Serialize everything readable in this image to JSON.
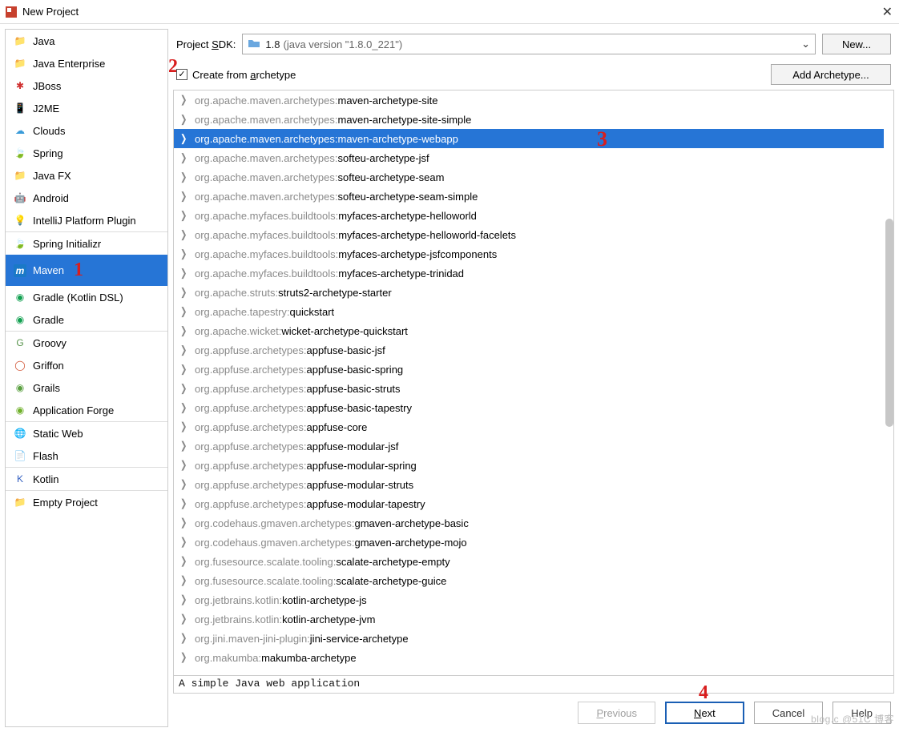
{
  "window": {
    "title": "New Project"
  },
  "sidebar": [
    {
      "label": "Java",
      "icon": "📁",
      "color": "#6aa7df",
      "sep": false
    },
    {
      "label": "Java Enterprise",
      "icon": "📁",
      "color": "#6aa7df",
      "sep": false
    },
    {
      "label": "JBoss",
      "icon": "✱",
      "color": "#d03030",
      "sep": false
    },
    {
      "label": "J2ME",
      "icon": "📱",
      "color": "#2c7bd1",
      "sep": false
    },
    {
      "label": "Clouds",
      "icon": "☁",
      "color": "#3a9bd9",
      "sep": false
    },
    {
      "label": "Spring",
      "icon": "🍃",
      "color": "#37a637",
      "sep": false
    },
    {
      "label": "Java FX",
      "icon": "📁",
      "color": "#6aa7df",
      "sep": false
    },
    {
      "label": "Android",
      "icon": "🤖",
      "color": "#76b000",
      "sep": false
    },
    {
      "label": "IntelliJ Platform Plugin",
      "icon": "💡",
      "color": "#999",
      "sep": true
    },
    {
      "label": "Spring Initializr",
      "icon": "🍃",
      "color": "#37a637",
      "sep": false
    },
    {
      "label": "Maven",
      "icon": "m",
      "color": "#fff",
      "bg": "#1a79c7",
      "selected": true,
      "annot": "1"
    },
    {
      "label": "Gradle (Kotlin DSL)",
      "icon": "◉",
      "color": "#11a050",
      "sep": false
    },
    {
      "label": "Gradle",
      "icon": "◉",
      "color": "#11a050",
      "sep": true
    },
    {
      "label": "Groovy",
      "icon": "G",
      "color": "#5b9650",
      "sep": false
    },
    {
      "label": "Griffon",
      "icon": "◯",
      "color": "#d05030",
      "sep": false
    },
    {
      "label": "Grails",
      "icon": "◉",
      "color": "#5aa040",
      "sep": false
    },
    {
      "label": "Application Forge",
      "icon": "◉",
      "color": "#6fb02a",
      "sep": true
    },
    {
      "label": "Static Web",
      "icon": "🌐",
      "color": "#2f92e0",
      "sep": false
    },
    {
      "label": "Flash",
      "icon": "📄",
      "color": "#c75d20",
      "sep": true
    },
    {
      "label": "Kotlin",
      "icon": "K",
      "color": "#335fc0",
      "sep": true
    },
    {
      "label": "Empty Project",
      "icon": "📁",
      "color": "#6aa7df",
      "sep": false
    }
  ],
  "sdk": {
    "label_pre": "Project ",
    "label_u": "S",
    "label_post": "DK:",
    "value": "1.8",
    "hint": "(java version \"1.8.0_221\")",
    "new_button": "New..."
  },
  "create_from": {
    "checked": true,
    "label_pre": "Create from ",
    "label_u": "a",
    "label_post": "rchetype",
    "add_button": "Add Archetype..."
  },
  "annotations": {
    "a1": "1",
    "a2": "2",
    "a3": "3",
    "a4": "4"
  },
  "archetypes": [
    {
      "prefix": "org.apache.maven.archetypes:",
      "name": "maven-archetype-site"
    },
    {
      "prefix": "org.apache.maven.archetypes:",
      "name": "maven-archetype-site-simple"
    },
    {
      "prefix": "org.apache.maven.archetypes:",
      "name": "maven-archetype-webapp",
      "selected": true
    },
    {
      "prefix": "org.apache.maven.archetypes:",
      "name": "softeu-archetype-jsf"
    },
    {
      "prefix": "org.apache.maven.archetypes:",
      "name": "softeu-archetype-seam"
    },
    {
      "prefix": "org.apache.maven.archetypes:",
      "name": "softeu-archetype-seam-simple"
    },
    {
      "prefix": "org.apache.myfaces.buildtools:",
      "name": "myfaces-archetype-helloworld"
    },
    {
      "prefix": "org.apache.myfaces.buildtools:",
      "name": "myfaces-archetype-helloworld-facelets"
    },
    {
      "prefix": "org.apache.myfaces.buildtools:",
      "name": "myfaces-archetype-jsfcomponents"
    },
    {
      "prefix": "org.apache.myfaces.buildtools:",
      "name": "myfaces-archetype-trinidad"
    },
    {
      "prefix": "org.apache.struts:",
      "name": "struts2-archetype-starter"
    },
    {
      "prefix": "org.apache.tapestry:",
      "name": "quickstart"
    },
    {
      "prefix": "org.apache.wicket:",
      "name": "wicket-archetype-quickstart"
    },
    {
      "prefix": "org.appfuse.archetypes:",
      "name": "appfuse-basic-jsf"
    },
    {
      "prefix": "org.appfuse.archetypes:",
      "name": "appfuse-basic-spring"
    },
    {
      "prefix": "org.appfuse.archetypes:",
      "name": "appfuse-basic-struts"
    },
    {
      "prefix": "org.appfuse.archetypes:",
      "name": "appfuse-basic-tapestry"
    },
    {
      "prefix": "org.appfuse.archetypes:",
      "name": "appfuse-core"
    },
    {
      "prefix": "org.appfuse.archetypes:",
      "name": "appfuse-modular-jsf"
    },
    {
      "prefix": "org.appfuse.archetypes:",
      "name": "appfuse-modular-spring"
    },
    {
      "prefix": "org.appfuse.archetypes:",
      "name": "appfuse-modular-struts"
    },
    {
      "prefix": "org.appfuse.archetypes:",
      "name": "appfuse-modular-tapestry"
    },
    {
      "prefix": "org.codehaus.gmaven.archetypes:",
      "name": "gmaven-archetype-basic"
    },
    {
      "prefix": "org.codehaus.gmaven.archetypes:",
      "name": "gmaven-archetype-mojo"
    },
    {
      "prefix": "org.fusesource.scalate.tooling:",
      "name": "scalate-archetype-empty"
    },
    {
      "prefix": "org.fusesource.scalate.tooling:",
      "name": "scalate-archetype-guice"
    },
    {
      "prefix": "org.jetbrains.kotlin:",
      "name": "kotlin-archetype-js"
    },
    {
      "prefix": "org.jetbrains.kotlin:",
      "name": "kotlin-archetype-jvm"
    },
    {
      "prefix": "org.jini.maven-jini-plugin:",
      "name": "jini-service-archetype"
    },
    {
      "prefix": "org.makumba:",
      "name": "makumba-archetype"
    }
  ],
  "description": "A simple Java web application",
  "footer": {
    "previous": "Previous",
    "next": "Next",
    "cancel": "Cancel",
    "help": "Help"
  },
  "watermark": "blog.c @51C 博客"
}
